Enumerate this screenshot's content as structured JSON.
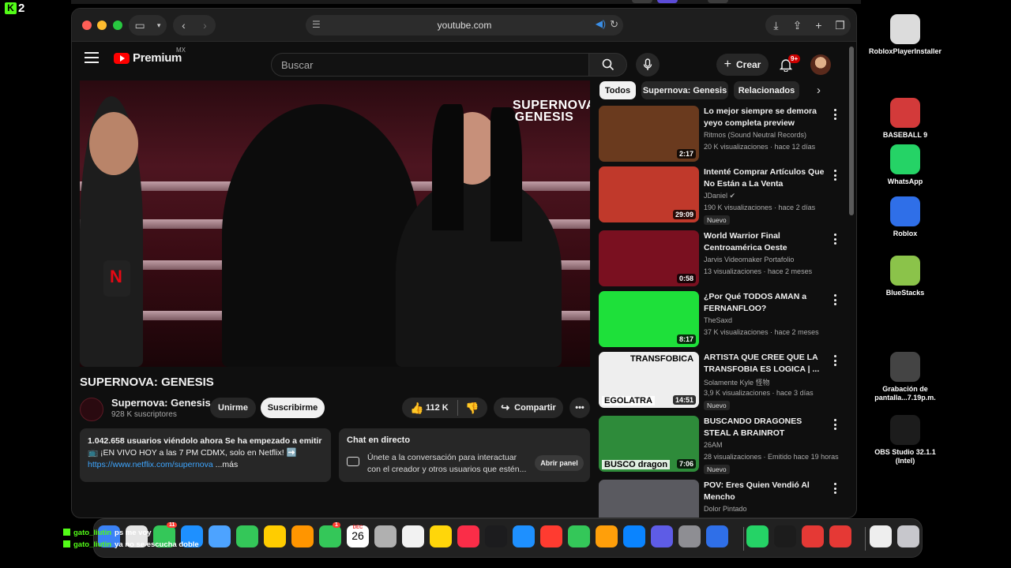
{
  "overlay": {
    "kick_count": "2"
  },
  "browser": {
    "url": "youtube.com"
  },
  "header": {
    "logo_text": "Premium",
    "region": "MX",
    "search_placeholder": "Buscar",
    "create_label": "Crear",
    "notifications_badge": "9+"
  },
  "video": {
    "watermark": "SUPERNOVA GENESIS",
    "title": "SUPERNOVA: GENESIS",
    "channel": "Supernova: Genesis",
    "subscribers": "928 K suscriptores",
    "join_label": "Unirme",
    "subscribe_label": "Suscribirme",
    "likes": "112 K",
    "share_label": "Compartir"
  },
  "description": {
    "line1": "1.042.658 usuarios viéndolo ahora  Se ha empezado a emitir en",
    "line2": "📺 ¡EN VIVO HOY a las 7 PM CDMX, solo en Netflix! ➡️",
    "link": "https://www.netflix.com/supernova",
    "more": "...más"
  },
  "chat": {
    "title": "Chat en directo",
    "text": "Únete a la conversación para interactuar con el creador y otros usuarios que estén...",
    "open_label": "Abrir panel"
  },
  "chips": [
    "Todos",
    "Supernova: Genesis",
    "Relacionados"
  ],
  "recommendations": [
    {
      "title": "Lo mejor siempre se demora yeyo completa preview",
      "channel": "Ritmos (Sound Neutral Records)",
      "meta": "20 K visualizaciones · hace 12 días",
      "duration": "2:17",
      "badge": "",
      "thumb_color": "#6a3a1e"
    },
    {
      "title": "Intenté Comprar Artículos Que No Están a La Venta",
      "channel": "JDaniel ✔",
      "meta": "190 K visualizaciones · hace 2 días",
      "duration": "29:09",
      "badge": "Nuevo",
      "thumb_color": "#c0392b"
    },
    {
      "title": "World Warrior Final Centroamérica Oeste",
      "channel": "Jarvis Videomaker Portafolio",
      "meta": "13 visualizaciones · hace 2 meses",
      "duration": "0:58",
      "badge": "",
      "thumb_color": "#7a1020"
    },
    {
      "title": "¿Por Qué TODOS AMAN a FERNANFLOO?",
      "channel": "TheSaxd",
      "meta": "37 K visualizaciones · hace 2 meses",
      "duration": "8:17",
      "badge": "",
      "thumb_color": "#1ee03a"
    },
    {
      "title": "ARTISTA QUE CREE QUE LA TRANSFOBIA ES LOGICA | ...",
      "channel": "Solamente Kyle 怪物",
      "meta": "3,9 K visualizaciones · hace 3 días",
      "duration": "14:51",
      "badge": "Nuevo",
      "thumb_color": "#eeeeee",
      "thumb_top": "TRANSFOBICA",
      "thumb_bottom": "EGOLATRA"
    },
    {
      "title": "BUSCANDO DRAGONES STEAL A BRAINROT",
      "channel": "26AM",
      "meta": "28 visualizaciones · Emitido hace 19 horas",
      "duration": "7:06",
      "badge": "Nuevo",
      "thumb_color": "#2e8b3a",
      "thumb_bottom": "BUSCO dragon"
    },
    {
      "title": "POV: Eres Quien Vendió Al Mencho",
      "channel": "Dolor Pintado",
      "meta": "",
      "duration": "",
      "badge": "",
      "thumb_color": "#5a5a60"
    }
  ],
  "desktop": [
    {
      "label": "RobloxPlayerInstaller",
      "icon": "installer-icon",
      "color": "#dcdcdc"
    },
    {
      "label": "BASEBALL 9",
      "icon": "baseball-icon",
      "color": "#d33a3a"
    },
    {
      "label": "WhatsApp",
      "icon": "whatsapp-icon",
      "color": "#25d366"
    },
    {
      "label": "Roblox",
      "icon": "roblox-icon",
      "color": "#2f6fe8"
    },
    {
      "label": "BlueStacks",
      "icon": "bluestacks-icon",
      "color": "#8bc34a"
    },
    {
      "label": "Grabación de pantalla...7.19p.m.",
      "icon": "recording-icon",
      "color": "#444"
    },
    {
      "label": "OBS Studio 32.1.1 (Intel)",
      "icon": "obs-icon",
      "color": "#1c1c1c"
    }
  ],
  "dock": {
    "mail_badge": "11",
    "facetime_badge": "1",
    "calendar_month": "DEC",
    "calendar_day": "26"
  },
  "chat_overlay": [
    {
      "user": "gato_liutin",
      "message": "ps me voy"
    },
    {
      "user": "gato_liutin",
      "message": "ya no se escucha doble"
    }
  ]
}
